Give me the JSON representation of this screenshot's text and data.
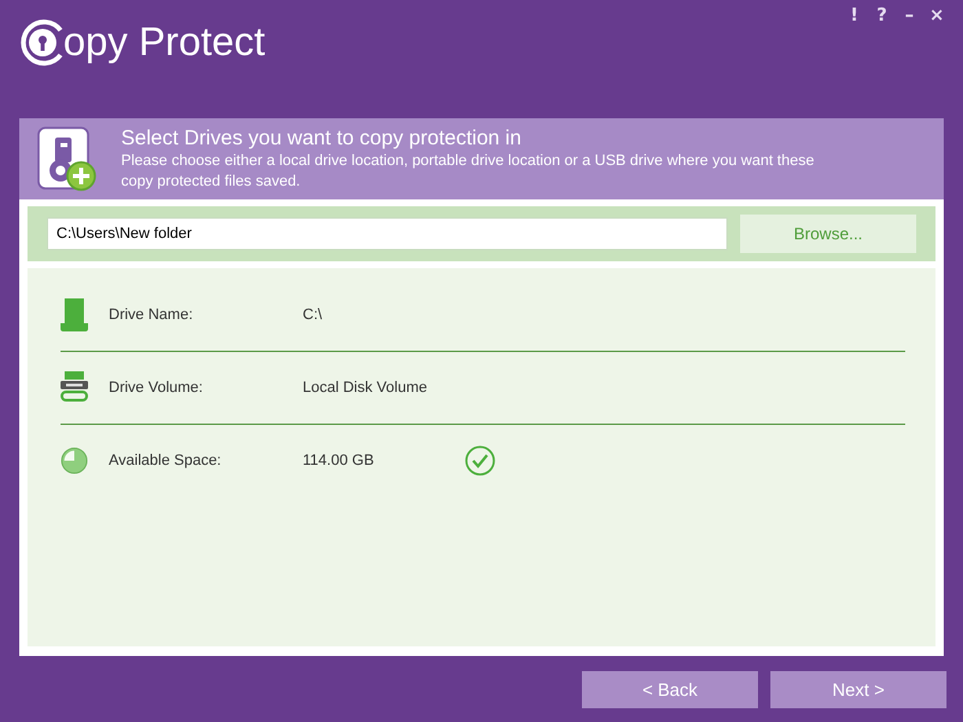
{
  "window": {
    "logo_text": "opy Protect",
    "controls": [
      "!",
      "?",
      "–",
      "×"
    ]
  },
  "header": {
    "title": "Select Drives you want to copy protection in",
    "description": "Please choose either a local drive location, portable drive location or a USB drive where you want these copy protected files saved."
  },
  "path": {
    "value": "C:\\Users\\New folder",
    "browse": "Browse..."
  },
  "drive_info": [
    {
      "kind": "name",
      "label": "Drive Name:",
      "value": "C:\\",
      "verified": false
    },
    {
      "kind": "volume",
      "label": "Drive Volume:",
      "value": "Local Disk Volume",
      "verified": false
    },
    {
      "kind": "space",
      "label": "Available Space:",
      "value": "114.00 GB",
      "verified": true
    }
  ],
  "buttons": [
    "< Back",
    "Next >"
  ]
}
